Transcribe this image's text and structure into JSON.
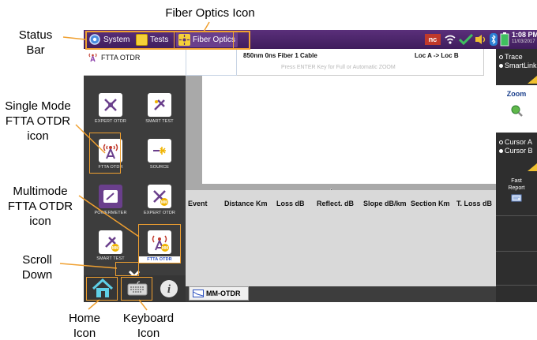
{
  "annotations": {
    "status_bar": "Status\nBar",
    "fiber_optics_icon": "Fiber Optics Icon",
    "single_mode": "Single Mode\nFTTA OTDR\nicon",
    "multimode": "Multimode\nFTTA OTDR\nicon",
    "scroll_down": "Scroll\nDown",
    "home_icon": "Home\nIcon",
    "keyboard_icon": "Keyboard\nIcon"
  },
  "statusbar": {
    "system": "System",
    "tests": "Tests",
    "fiber_optics": "Fiber Optics",
    "time": "1:08 PM",
    "date": "11/03/2017"
  },
  "header": {
    "title": "FTTA OTDR",
    "info": "850nm 0ns Fiber 1 Cable",
    "loc": "Loc A -> Loc B",
    "hint": "Press ENTER Key for Full or Automatic ZOOM"
  },
  "apps": [
    {
      "label": "EXPERT OTDR"
    },
    {
      "label": "SMART TEST"
    },
    {
      "label": "FTTA OTDR"
    },
    {
      "label": "SOURCE"
    },
    {
      "label": "POWERMETER"
    },
    {
      "label": "EXPERT OTDR"
    },
    {
      "label": "SMART TEST"
    },
    {
      "label": "FTTA OTDR"
    }
  ],
  "event_table": {
    "columns": [
      "Event",
      "Distance Km",
      "Loss dB",
      "Reflect. dB",
      "Slope dB/km",
      "Section Km",
      "T. Loss dB"
    ]
  },
  "tabs": {
    "mm": "MM-OTDR"
  },
  "right_menu": {
    "trace": "Trace",
    "smartlink": "SmartLink",
    "zoom": "Zoom",
    "cursor_a": "Cursor A",
    "cursor_b": "Cursor B",
    "fast_report": "Fast\nReport"
  },
  "colors": {
    "status_bar": "#4a2468",
    "highlight_orange": "#f0a030",
    "mm_badge": "#f0b400",
    "selected_label_bg": "#ffffff"
  }
}
